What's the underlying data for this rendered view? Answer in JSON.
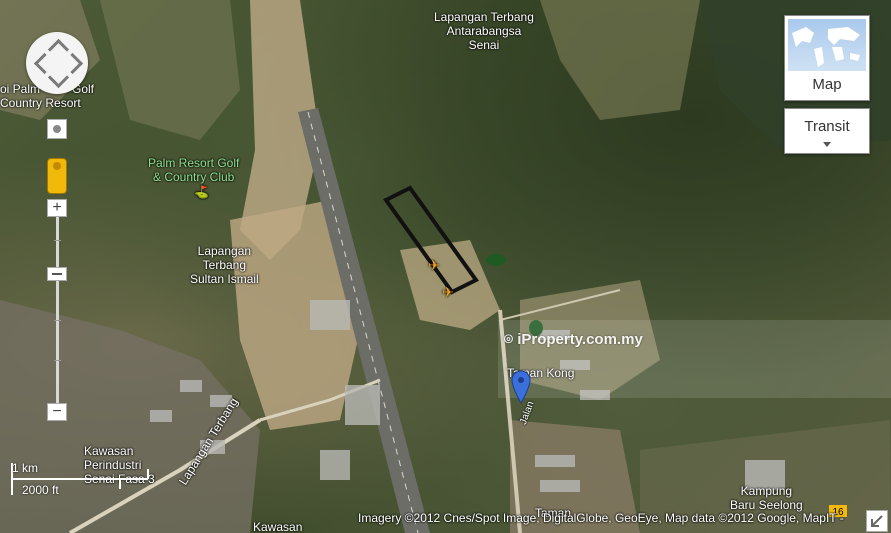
{
  "map": {
    "place_labels": [
      {
        "id": "senai-airport-top",
        "lines": [
          "Lapangan Terbang",
          "Antarabangsa",
          "Senai"
        ]
      },
      {
        "id": "palm-resort-country",
        "lines": [
          "oi Palm",
          "Country Resort"
        ]
      },
      {
        "id": "golf-fragment",
        "lines": [
          "Golf"
        ]
      },
      {
        "id": "palm-resort-golf",
        "lines": [
          "Palm Resort Golf",
          "& Country Club"
        ]
      },
      {
        "id": "sultan-ismail",
        "lines": [
          "Lapangan",
          "Terbang",
          "Sultan Ismail"
        ]
      },
      {
        "id": "kawasan-perindustrian",
        "lines": [
          "Kawasan",
          "Perindustri",
          "Senai Fasa 3"
        ]
      },
      {
        "id": "kawasan-bottom",
        "lines": [
          "Kawasan"
        ]
      },
      {
        "id": "lapangan-terbang-road",
        "lines": [
          "Lapangan Terbang"
        ]
      },
      {
        "id": "taman-top",
        "lines": [
          "Taman Kong"
        ]
      },
      {
        "id": "taman-bottom",
        "lines": [
          "Taman"
        ]
      },
      {
        "id": "jalan-label",
        "lines": [
          "Jalan"
        ]
      },
      {
        "id": "kampung-baru-seelong",
        "lines": [
          "Kampung",
          "Baru Seelong"
        ]
      }
    ],
    "road_shield": "16",
    "watermark": "iProperty.com.my",
    "attribution": "Imagery ©2012 Cnes/Spot Image, DigitalGlobe, GeoEye, Map data ©2012 Google, MapIT -",
    "scale": {
      "km": "1 km",
      "ft": "2000 ft"
    },
    "map_type_button": "Map",
    "transit_button": "Transit",
    "zoom_in": "+",
    "zoom_out": "−"
  },
  "icons": [
    "pan-control-icon",
    "locate-icon",
    "pegman-icon",
    "zoom-in-icon",
    "zoom-out-icon",
    "golf-marker-icon",
    "airport-marker-icon",
    "location-pin-icon",
    "expand-corner-icon"
  ],
  "colors": {
    "pin": "#3a6fdc",
    "polygon": "#111111",
    "pegman": "#f1b90a"
  }
}
